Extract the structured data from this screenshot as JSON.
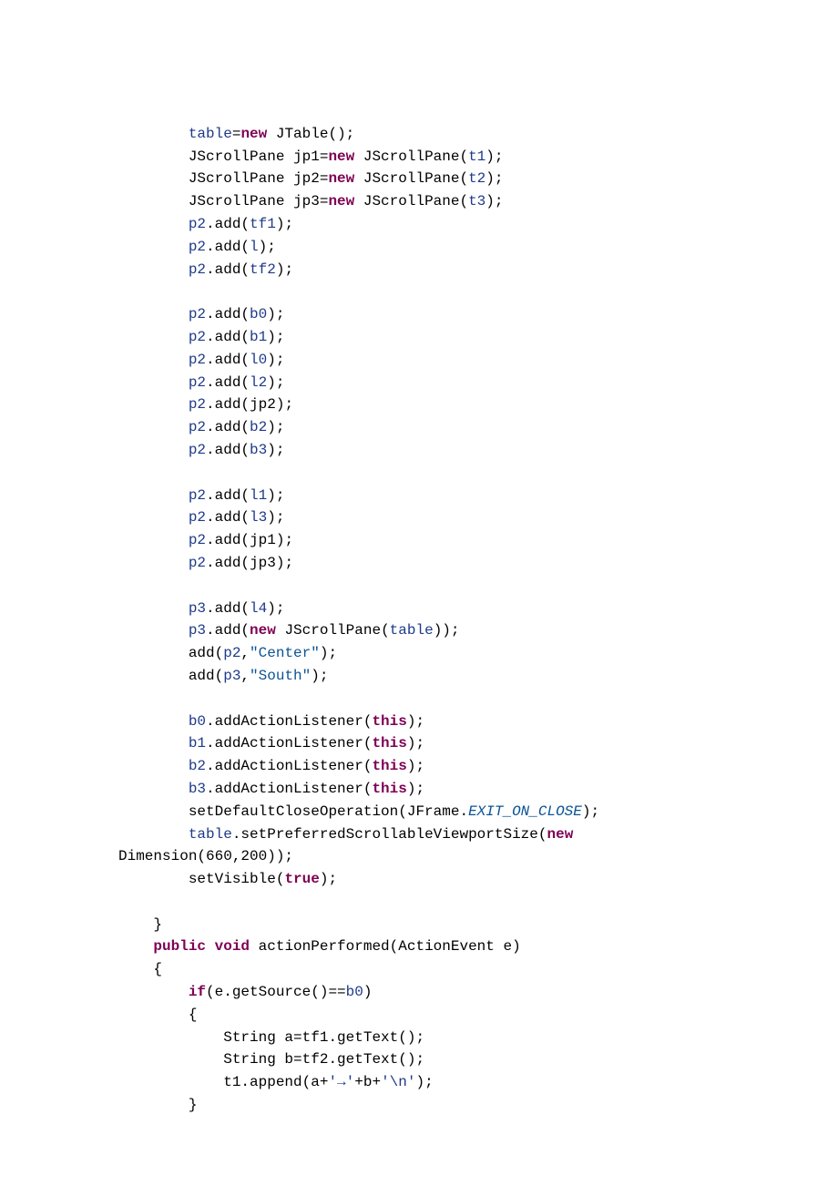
{
  "code": {
    "indent2": "        ",
    "indent1": "    ",
    "indent3": "            ",
    "kw_new": "new",
    "kw_public": "public",
    "kw_void": "void",
    "kw_if": "if",
    "kw_this": "this",
    "kw_true": "true",
    "f_table": "table",
    "f_tf1": "tf1",
    "f_tf2": "tf2",
    "f_l": "l",
    "f_l0": "l0",
    "f_l1": "l1",
    "f_l2": "l2",
    "f_l3": "l3",
    "f_l4": "l4",
    "f_t1": "t1",
    "f_t2": "t2",
    "f_t3": "t3",
    "f_p2": "p2",
    "f_p3": "p3",
    "f_b0": "b0",
    "f_b1": "b1",
    "f_b2": "b2",
    "f_b3": "b3",
    "s_center": "\"Center\"",
    "s_south": "\"South\"",
    "c_exit": "EXIT_ON_CLOSE",
    "txt_jtable": " JTable();",
    "txt_jscrollpane_open": " JScrollPane(",
    "txt_jscrollpane_class": "JScrollPane jp1=",
    "txt_jscrollpane_class2": "JScrollPane jp2=",
    "txt_jscrollpane_class3": "JScrollPane jp3=",
    "txt_close_stmt": ");",
    "txt_add_open": ".add(",
    "txt_close_brace": "}",
    "txt_open_brace": "{",
    "txt_add_p2": "add(",
    "txt_comma": ",",
    "txt_addactionlistener": ".addActionListener(",
    "txt_setdefault": "setDefaultCloseOperation(JFrame.",
    "txt_setpreferred": ".setPreferredScrollableViewportSize(",
    "txt_dimension": "Dimension(660,200));",
    "txt_setvisible": "setVisible(",
    "txt_actionperformed": " actionPerformed(ActionEvent e)",
    "txt_getsource": "(e.getSource()==",
    "txt_string_a": "String a=tf1.getText();",
    "txt_string_b": "String b=tf2.getText();",
    "txt_t1append_pre": "t1.append(a+",
    "txt_arrow": "'→'",
    "txt_plusb": "+b+",
    "txt_nl": "'\\n'",
    "txt_eq": "=",
    "txt_rparen": ")",
    "txt_jp1": "jp1",
    "txt_jp2": "jp2",
    "txt_jp3": "jp3",
    "txt_space": " "
  }
}
